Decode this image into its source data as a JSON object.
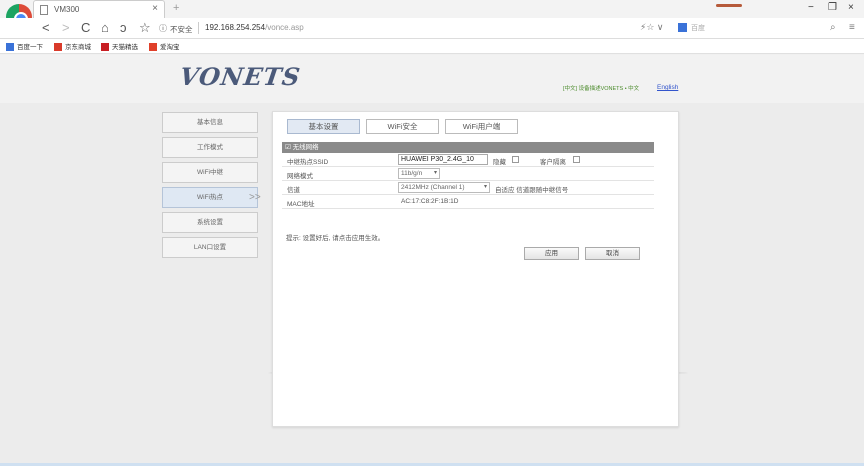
{
  "browser": {
    "tab_title": "VM300",
    "tab_close": "×",
    "new_tab": "+",
    "nav_back": "<",
    "nav_forward": ">",
    "nav_reload": "C",
    "nav_home": "⌂",
    "nav_undo": "ↄ",
    "nav_star": "☆",
    "security_icon": "ⓘ",
    "security_text": "不安全",
    "url_host": "192.168.254.254",
    "url_path": "/vonce.asp",
    "addr_right": "⚡☆ ∨",
    "search_placeholder": "百度",
    "window_controls": [
      "−",
      "❐",
      "×"
    ],
    "bookmarks": [
      "百度一下",
      "京东商城",
      "天猫精选",
      "爱淘宝"
    ]
  },
  "header": {
    "logo": "VONETS",
    "language_text": "[中文] 设备描述VONETS • 中文",
    "language_link": "English"
  },
  "sidebar": {
    "items": [
      {
        "label": "基本信息"
      },
      {
        "label": "工作模式"
      },
      {
        "label": "WiFi中继"
      },
      {
        "label": "WiFi热点"
      },
      {
        "label": "系统设置"
      },
      {
        "label": "LAN口设置"
      }
    ],
    "active_arrow": ">>"
  },
  "panel": {
    "tabs": [
      "基本设置",
      "WiFi安全",
      "WiFi用户端"
    ],
    "section_title": "☑ 无线网络",
    "rows": {
      "ssid_label": "中继热点SSID",
      "ssid_value": "HUAWEI P30_2.4G_10",
      "hide_label": "隐藏",
      "isolation_label": "客户隔离",
      "mode_label": "网络模式",
      "mode_value": "11b/g/n",
      "channel_label": "信道",
      "channel_value": "2412MHz (Channel 1)",
      "channel_note": "自适应 信道跟随中继信号",
      "mac_label": "MAC地址",
      "mac_value": "AC:17:C8:2F:1B:1D"
    },
    "note": "提示: 设置好后, 请点击应用生效。",
    "apply_label": "应用",
    "cancel_label": "取消"
  }
}
